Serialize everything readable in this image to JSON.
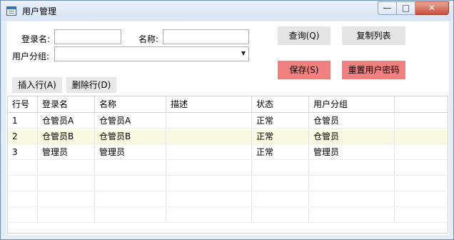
{
  "window": {
    "title": "用户管理",
    "controls": {
      "minimize": "—",
      "maximize": "□",
      "close": "✕"
    }
  },
  "form": {
    "login_label": "登录名:",
    "login_value": "",
    "name_label": "名称:",
    "name_value": "",
    "group_label": "用户分组:",
    "group_value": ""
  },
  "buttons": {
    "query": "查询(Q)",
    "copy_list": "复制列表",
    "save": "保存(S)",
    "reset_password": "重置用户密码",
    "insert_row": "插入行(A)",
    "delete_row": "删除行(D)"
  },
  "table": {
    "columns": [
      "行号",
      "登录名",
      "名称",
      "描述",
      "状态",
      "用户分组"
    ],
    "rows": [
      [
        "1",
        "仓管员A",
        "仓管员A",
        "",
        "正常",
        "仓管员"
      ],
      [
        "2",
        "仓管员B",
        "仓管员B",
        "",
        "正常",
        "仓管员"
      ],
      [
        "3",
        "管理员",
        "管理员",
        "",
        "正常",
        "管理员"
      ]
    ],
    "selected_row_index": 1
  },
  "colors": {
    "accent_red": "#f08080",
    "selected_row": "#fafae2",
    "title_bar": "#dde8f5"
  }
}
